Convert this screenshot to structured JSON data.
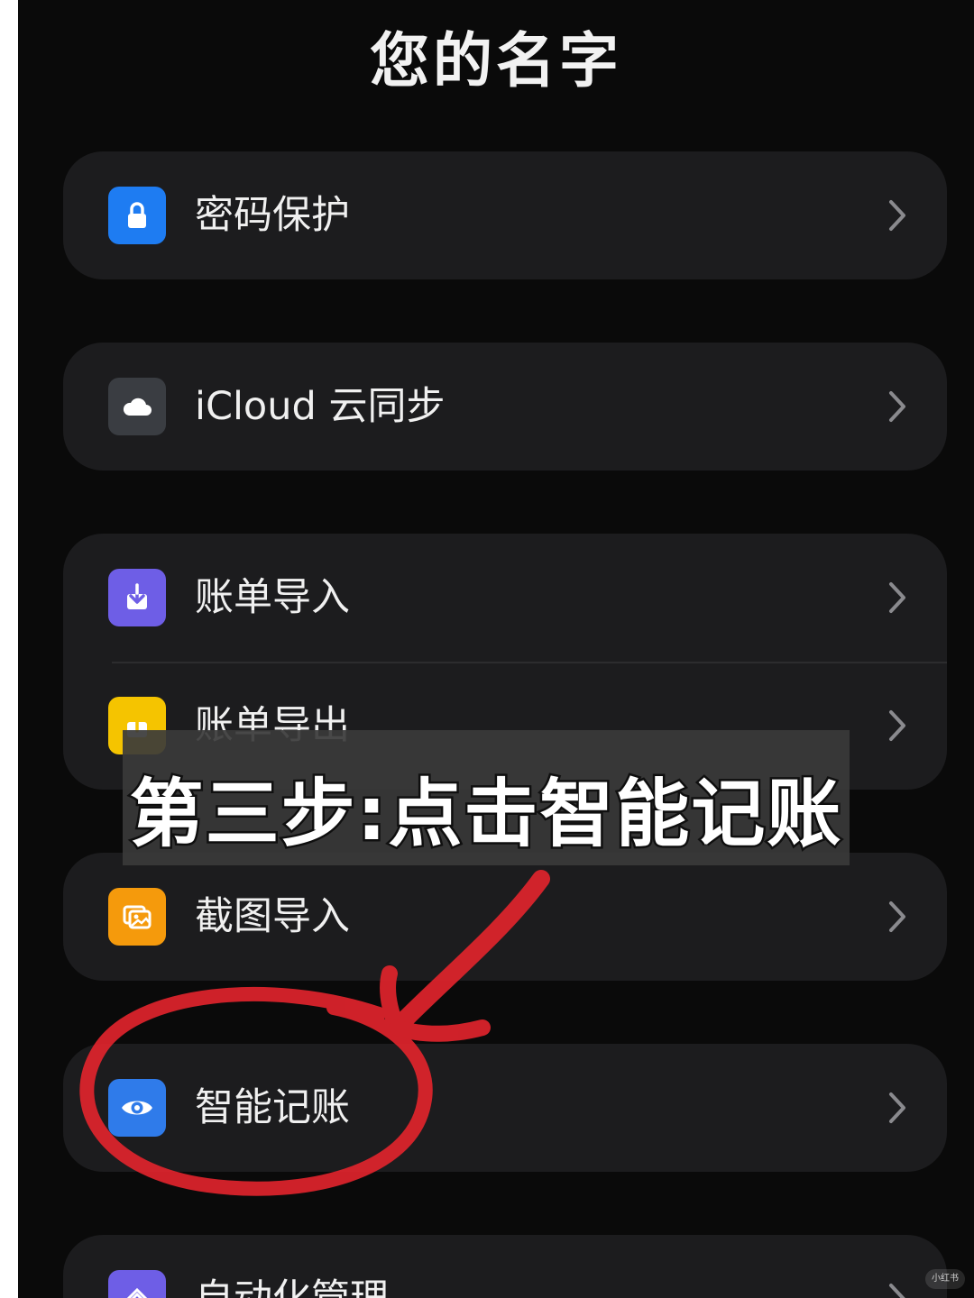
{
  "page_title": "您的名字",
  "groups": [
    {
      "items": [
        {
          "label": "密码保护",
          "icon": "lock-icon",
          "icon_color": "#1e7cf2"
        }
      ]
    },
    {
      "items": [
        {
          "label": "iCloud 云同步",
          "icon": "cloud-icon",
          "icon_color": "#3a3d42"
        }
      ]
    },
    {
      "items": [
        {
          "label": "账单导入",
          "icon": "import-icon",
          "icon_color": "#6e5ee6"
        },
        {
          "label": "账单导出",
          "icon": "export-icon",
          "icon_color": "#f5c400"
        }
      ]
    },
    {
      "items": [
        {
          "label": "截图导入",
          "icon": "image-icon",
          "icon_color": "#f59a0c"
        }
      ]
    },
    {
      "items": [
        {
          "label": "智能记账",
          "icon": "eye-icon",
          "icon_color": "#2f7bea"
        }
      ]
    },
    {
      "items": [
        {
          "label": "自动化管理",
          "icon": "layers-icon",
          "icon_color": "#6e5ee6"
        }
      ]
    }
  ],
  "overlay_caption": "第三步:点击智能记账",
  "watermark_text": "小红书",
  "annotation_color": "#e0242c"
}
